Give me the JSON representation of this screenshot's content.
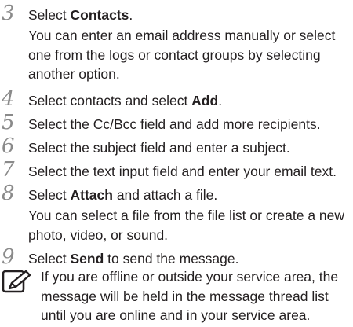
{
  "steps": [
    {
      "number": "3",
      "before": "Select ",
      "bold": "Contacts",
      "after": ".",
      "note": "You can enter an email address manually or select one from the logs or contact groups by selecting another option."
    },
    {
      "number": "4",
      "before": "Select contacts and select ",
      "bold": "Add",
      "after": "."
    },
    {
      "number": "5",
      "text": "Select the Cc/Bcc field and add more recipients."
    },
    {
      "number": "6",
      "text": "Select the subject field and enter a subject."
    },
    {
      "number": "7",
      "text": "Select the text input field and enter your email text."
    },
    {
      "number": "8",
      "before": "Select ",
      "bold": "Attach",
      "after": " and attach a file.",
      "note": "You can select a file from the file list or create a new photo, video, or sound."
    },
    {
      "number": "9",
      "before": "Select ",
      "bold": "Send",
      "after": " to send the message."
    }
  ],
  "note_box": {
    "icon": "note-pencil-icon",
    "text": "If you are offline or outside your service area, the message will be held in the message thread list until you are online and in your service area."
  },
  "colors": {
    "step_number": "#8a8a8a",
    "text": "#231f20",
    "icon": "#231f20"
  }
}
